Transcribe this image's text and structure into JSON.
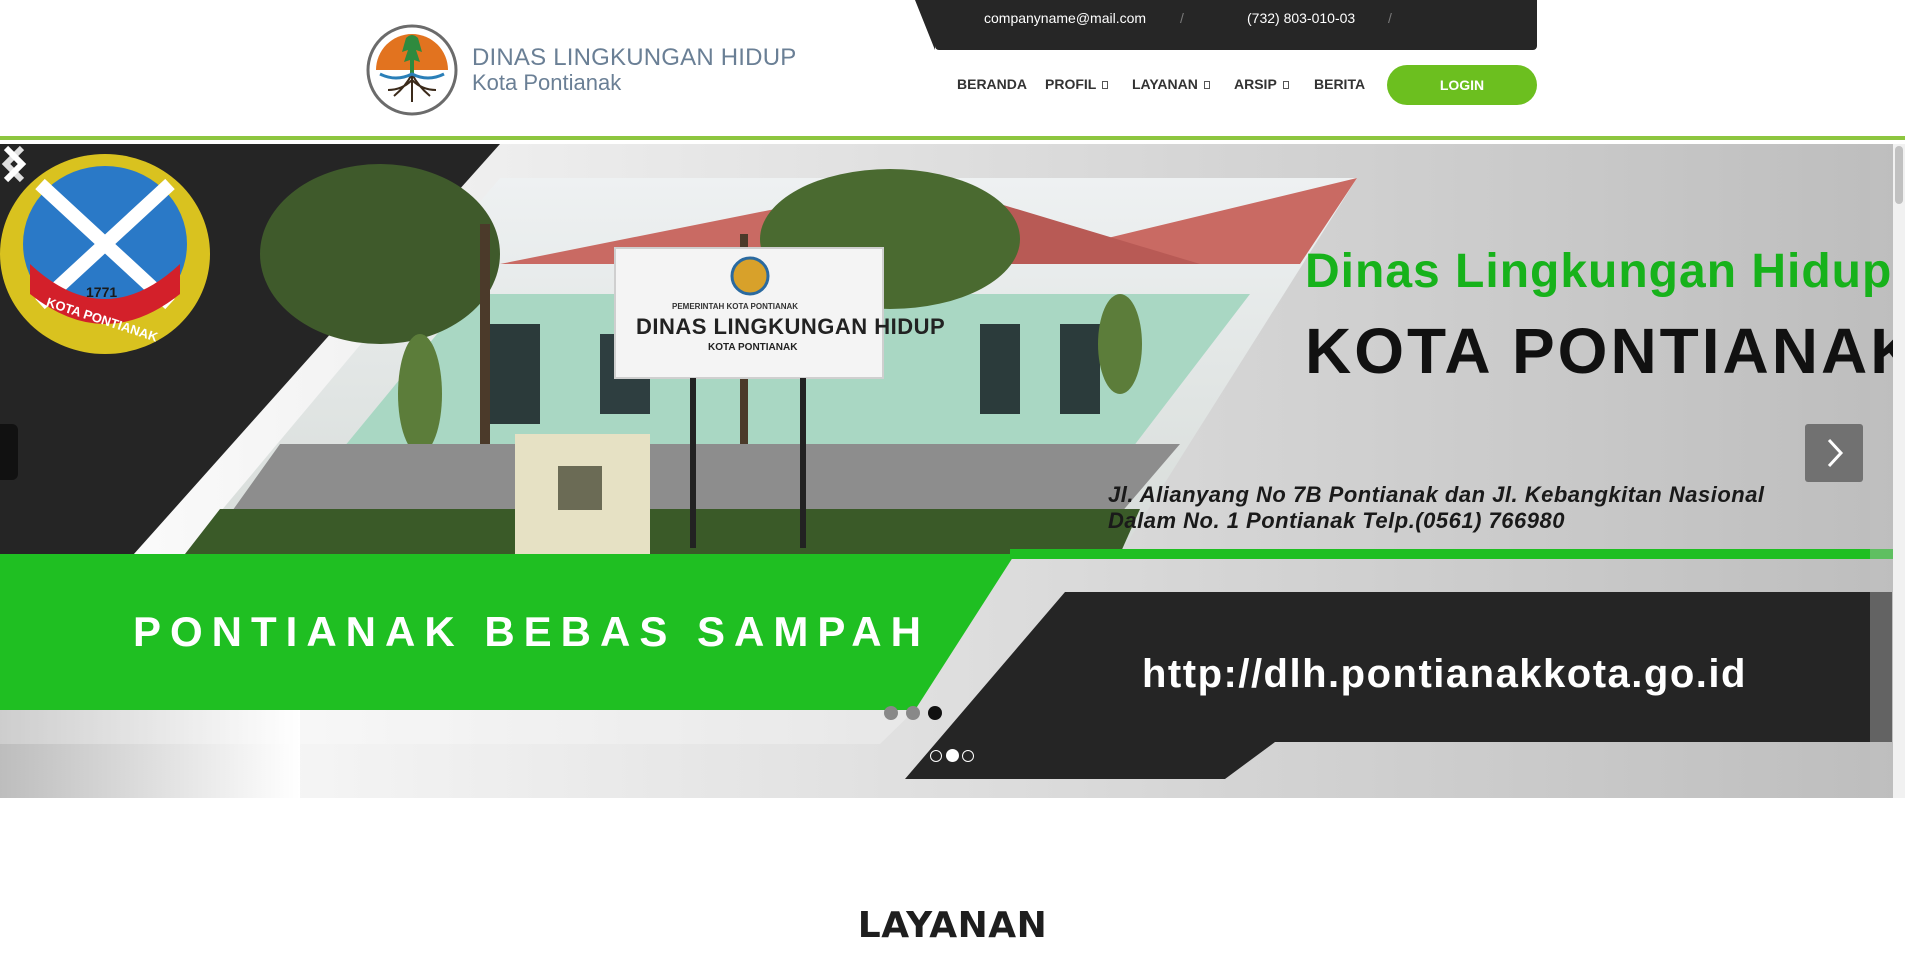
{
  "header": {
    "brand_title": "DINAS LINGKUNGAN HIDUP",
    "brand_subtitle": "Kota Pontianak",
    "email": "companyname@mail.com",
    "phone": "(732) 803-010-03",
    "separator": "/",
    "accent_color": "#8dc63f"
  },
  "nav": {
    "items": [
      {
        "label": "BERANDA",
        "has_dropdown": false
      },
      {
        "label": "PROFIL",
        "has_dropdown": true
      },
      {
        "label": "LAYANAN",
        "has_dropdown": true
      },
      {
        "label": "ARSIP",
        "has_dropdown": true
      },
      {
        "label": "BERITA",
        "has_dropdown": false
      }
    ],
    "login_label": "LOGIN",
    "login_color": "#6cbf1f"
  },
  "slider": {
    "headline_green": "Dinas Lingkungan Hidup",
    "headline_black": "KOTA PONTIANAK",
    "address_line1": "Jl. Alianyang No 7B Pontianak dan Jl. Kebangkitan Nasional",
    "address_line2": "Dalam No. 1 Pontianak Telp.(0561) 766980",
    "banner_text": "PONTIANAK BEBAS SAMPAH",
    "url_text": "http://dlh.pontianakkota.go.id",
    "sign_line1": "PEMERINTAH KOTA PONTIANAK",
    "sign_line2": "DINAS LINGKUNGAN HIDUP",
    "sign_line3": "KOTA PONTIANAK",
    "emblem_text": "KOTA PONTIANAK",
    "emblem_year": "1771",
    "active_slide": 2,
    "slide_count": 3
  },
  "section": {
    "title": "LAYANAN"
  }
}
